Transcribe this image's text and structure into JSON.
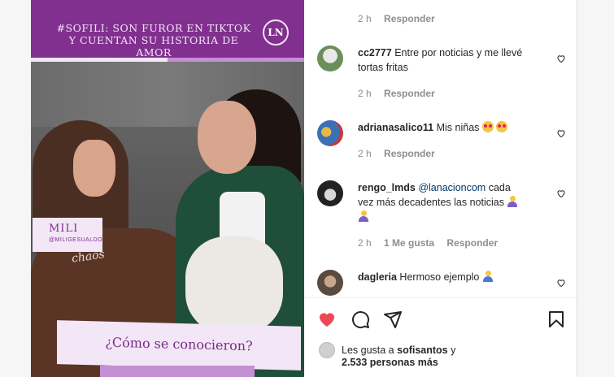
{
  "media": {
    "banner_title": "#SOFILI: SON FUROR EN TIKTOK Y CUENTAN SU HISTORIA DE AMOR",
    "logo": "LN",
    "name_tag": "MILI",
    "name_handle": "@MILIGESUALDO",
    "hoodie_text": "chaos",
    "question": "¿Cómo se conocieron?",
    "progress": 0.5
  },
  "comments": {
    "top_meta": {
      "time": "2 h",
      "reply": "Responder"
    },
    "items": [
      {
        "user": "cc2777",
        "text": "Entre por noticias y me llevé tortas fritas",
        "time": "2 h",
        "likes": "",
        "reply": "Responder"
      },
      {
        "user": "adrianasalico11",
        "text": "Mis niñas",
        "emoji": [
          "heart-eyes-emoji",
          "heart-eyes-emoji"
        ],
        "time": "2 h",
        "likes": "",
        "reply": "Responder"
      },
      {
        "user": "rengo_lmds",
        "mention": "@lanacioncom",
        "text": "cada vez más decadentes las noticias",
        "emoji": [
          "facepalm-emoji",
          "facepalm-emoji"
        ],
        "time": "2 h",
        "likes": "1 Me gusta",
        "reply": "Responder"
      },
      {
        "user": "dagleria",
        "text": "Hermoso ejemplo",
        "emoji": [
          "person-emoji"
        ]
      }
    ]
  },
  "likes": {
    "prefix": "Les gusta a",
    "user": "sofisantos",
    "suffix": "y",
    "count": "2.533 personas más"
  },
  "colors": {
    "brand_purple": "#81308f",
    "like_red": "#ed4956",
    "light_lilac": "#f3e6f6"
  },
  "icons": [
    "heart-filled-icon",
    "comment-icon",
    "share-icon",
    "bookmark-icon",
    "heart-outline-icon"
  ]
}
